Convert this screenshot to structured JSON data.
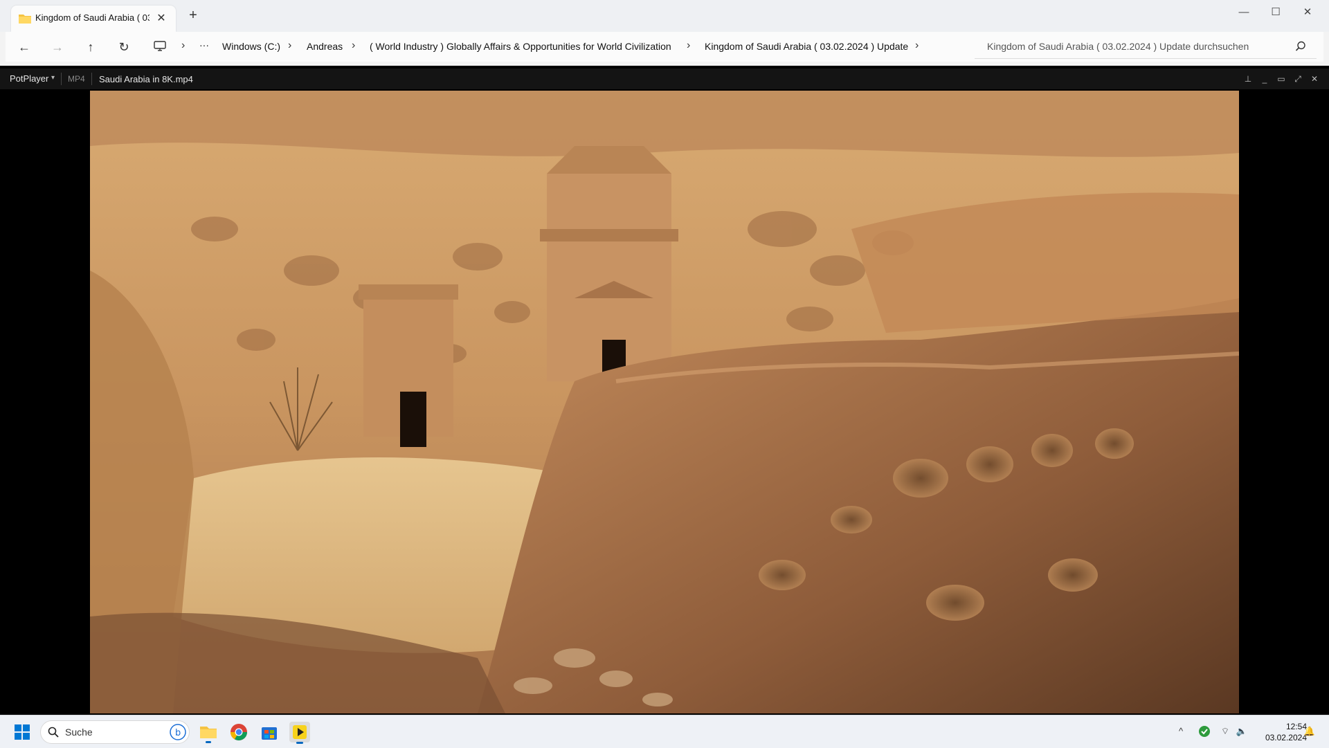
{
  "explorer": {
    "tab": {
      "title": "Kingdom of Saudi Arabia ( 03.02.2024 ) Update"
    },
    "breadcrumb": [
      "Windows (C:)",
      "Andreas",
      "( World Industry ) Globally Affairs & Opportunities for World Civilization",
      "Kingdom of Saudi Arabia ( 03.02.2024 ) Update"
    ],
    "search_placeholder": "Kingdom of Saudi Arabia ( 03.02.2024 ) Update durchsuchen",
    "overflow_label": "···"
  },
  "player": {
    "app_name": "PotPlayer",
    "format": "MP4",
    "filename": "Saudi Arabia in 8K.mp4"
  },
  "taskbar": {
    "search_label": "Suche",
    "time": "12:54",
    "date": "03.02.2024",
    "apps": [
      "start-button",
      "file-explorer",
      "chrome",
      "microsoft-store",
      "potplayer"
    ]
  },
  "colors": {
    "accent": "#0067c0",
    "folder_yellow": "#f5c342",
    "player_bg": "#141414"
  }
}
